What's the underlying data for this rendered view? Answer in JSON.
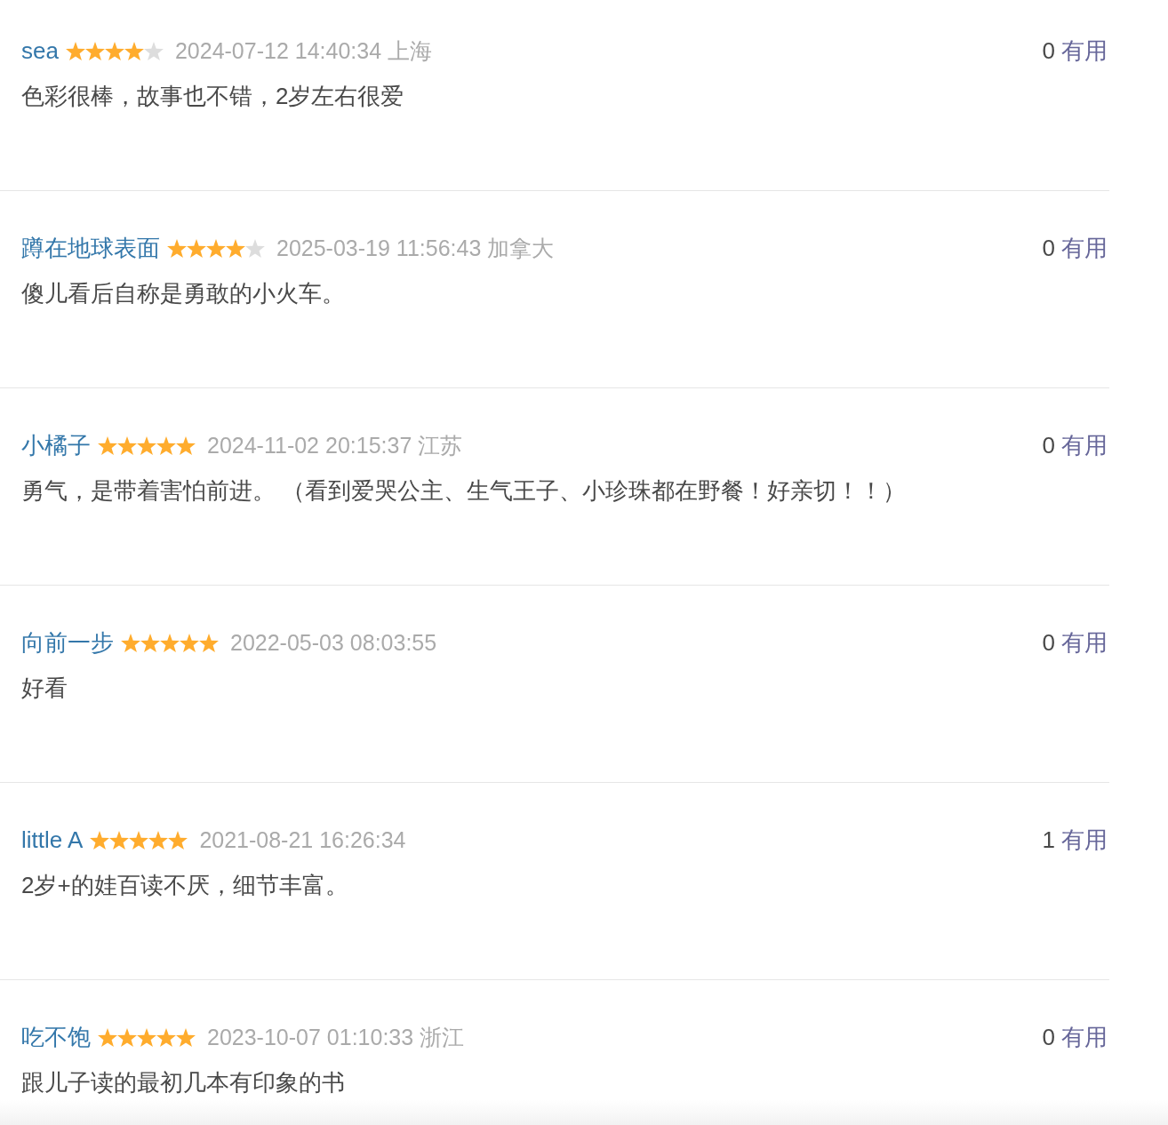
{
  "reviews": [
    {
      "user": "sea",
      "stars": 4,
      "time": "2024-07-12 14:40:34",
      "location": "上海",
      "comment": "色彩很棒，故事也不错，2岁左右很爱",
      "votes": "0",
      "vote_label": "有用"
    },
    {
      "user": "蹲在地球表面",
      "stars": 4,
      "time": "2025-03-19 11:56:43",
      "location": "加拿大",
      "comment": "傻儿看后自称是勇敢的小火车。",
      "votes": "0",
      "vote_label": "有用"
    },
    {
      "user": "小橘子",
      "stars": 5,
      "time": "2024-11-02 20:15:37",
      "location": "江苏",
      "comment": "勇气，是带着害怕前进。 （看到爱哭公主、生气王子、小珍珠都在野餐！好亲切！！）",
      "votes": "0",
      "vote_label": "有用"
    },
    {
      "user": "向前一步",
      "stars": 5,
      "time": "2022-05-03 08:03:55",
      "comment": "好看",
      "votes": "0",
      "vote_label": "有用"
    },
    {
      "user": "little A",
      "stars": 5,
      "time": "2021-08-21 16:26:34",
      "comment": "2岁+的娃百读不厌，细节丰富。",
      "votes": "1",
      "vote_label": "有用"
    },
    {
      "user": "吃不饱",
      "stars": 5,
      "time": "2023-10-07 01:10:33",
      "location": "浙江",
      "comment": "跟儿子读的最初几本有印象的书",
      "votes": "0",
      "vote_label": "有用"
    }
  ]
}
